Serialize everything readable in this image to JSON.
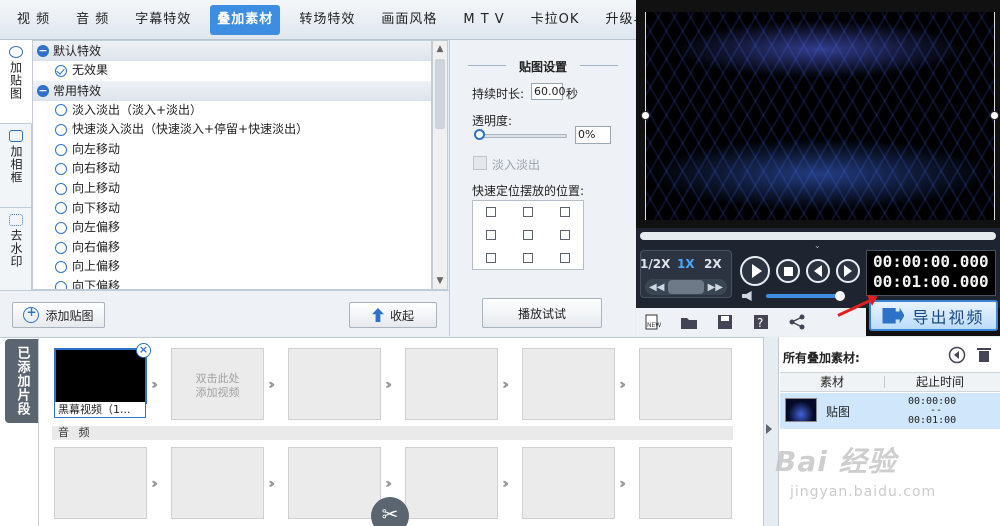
{
  "tabs": [
    "视 频",
    "音 频",
    "字幕特效",
    "叠加素材",
    "转场特效",
    "画面风格",
    "M T V",
    "卡拉OK",
    "升级与服务"
  ],
  "active_tab": 3,
  "side_tabs": [
    "加贴图",
    "加相框",
    "去水印"
  ],
  "effects": {
    "groups": [
      {
        "name": "默认特效",
        "items": [
          "无效果"
        ]
      },
      {
        "name": "常用特效",
        "items": [
          "淡入淡出（淡入+淡出）",
          "快速淡入淡出（快速淡入+停留+快速淡出）",
          "向左移动",
          "向右移动",
          "向上移动",
          "向下移动",
          "向左偏移",
          "向右偏移",
          "向上偏移",
          "向下偏移"
        ]
      }
    ]
  },
  "buttons": {
    "add_sticker": "添加贴图",
    "collapse": "收起",
    "preview": "播放试试",
    "export": "导出视频"
  },
  "settings": {
    "title": "贴图设置",
    "duration_label": "持续时长:",
    "duration_value": "60.00",
    "duration_unit": "秒",
    "opacity_label": "透明度:",
    "opacity_value": "0%",
    "opacity_level": 0,
    "fade_label": "淡入淡出",
    "position_label": "快速定位摆放的位置:"
  },
  "player": {
    "speeds": [
      "1/2X",
      "1X",
      "2X"
    ],
    "active_speed": 1,
    "time_current": "00:00:00.000",
    "time_total": "00:01:00.000",
    "progress": 0,
    "volume": 0.95
  },
  "toolbar_icons": [
    "new-icon",
    "folder-icon",
    "save-icon",
    "help-icon",
    "share-icon"
  ],
  "timeline": {
    "tab_label": "已添加片段",
    "clip_label": "黑幕视频（1...",
    "empty_hint": "双击此处\n添加视频",
    "audio_label": "音 频"
  },
  "materials": {
    "title": "所有叠加素材:",
    "col_material": "素材",
    "col_time": "起止时间",
    "rows": [
      {
        "name": "贴图",
        "start": "00:00:00",
        "end": "00:01:00"
      }
    ]
  },
  "watermark": {
    "logo": "Bai 经验",
    "url": "jingyan.baidu.com"
  },
  "colors": {
    "accent": "#3d8ee0",
    "highlight_row": "#cfe6fb",
    "arrow": "#e02020"
  }
}
